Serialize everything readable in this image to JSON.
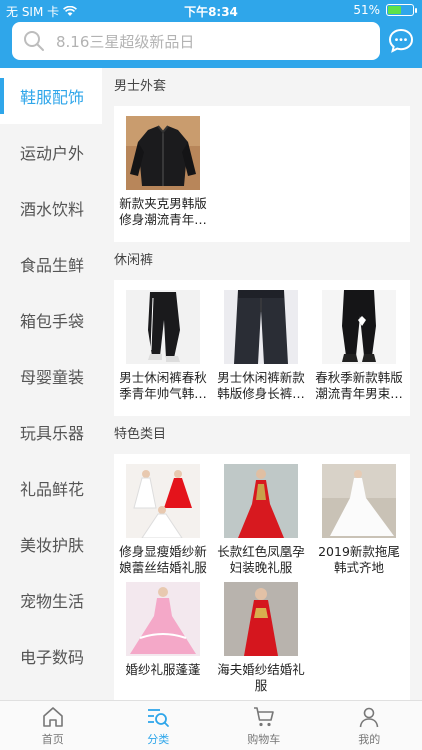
{
  "status_bar": {
    "carrier": "无 SIM 卡",
    "time": "下午8:34",
    "battery": "51%",
    "battery_fraction": 0.51
  },
  "search": {
    "placeholder": "8.16三星超级新品日"
  },
  "sidebar": {
    "items": [
      {
        "label": "鞋服配饰",
        "active": true
      },
      {
        "label": "运动户外"
      },
      {
        "label": "酒水饮料"
      },
      {
        "label": "食品生鲜"
      },
      {
        "label": "箱包手袋"
      },
      {
        "label": "母婴童装"
      },
      {
        "label": "玩具乐器"
      },
      {
        "label": "礼品鲜花"
      },
      {
        "label": "美妆护肤"
      },
      {
        "label": "宠物生活"
      },
      {
        "label": "电子数码"
      }
    ]
  },
  "sections": [
    {
      "title": "男士外套",
      "items": [
        {
          "name": "新款夹克男韩版修身潮流青年…",
          "icon": "jacket-image"
        }
      ]
    },
    {
      "title": "休闲裤",
      "items": [
        {
          "name": "男士休闲裤春秋季青年帅气韩…",
          "icon": "pants-image"
        },
        {
          "name": "男士休闲裤新款韩版修身长裤…",
          "icon": "pants-image"
        },
        {
          "name": "春秋季新款韩版潮流青年男束…",
          "icon": "pants-image"
        }
      ]
    },
    {
      "title": "特色类目",
      "items": [
        {
          "name": "修身显瘦婚纱新娘蕾丝结婚礼服",
          "icon": "wedding-dress-image"
        },
        {
          "name": "长款红色凤凰孕妇装晚礼服",
          "icon": "red-gown-image"
        },
        {
          "name": "2019新款拖尾韩式齐地",
          "icon": "white-gown-image"
        },
        {
          "name": "婚纱礼服蓬蓬",
          "icon": "pink-gown-image"
        },
        {
          "name": "海夫婚纱结婚礼服",
          "icon": "red-qipao-image"
        }
      ]
    }
  ],
  "tabbar": {
    "items": [
      {
        "label": "首页",
        "icon": "home-icon"
      },
      {
        "label": "分类",
        "icon": "category-search-icon",
        "active": true
      },
      {
        "label": "购物车",
        "icon": "cart-icon"
      },
      {
        "label": "我的",
        "icon": "user-icon"
      }
    ]
  },
  "colors": {
    "accent": "#2fa6ea",
    "sidebar_bg": "#f4f4f4"
  }
}
